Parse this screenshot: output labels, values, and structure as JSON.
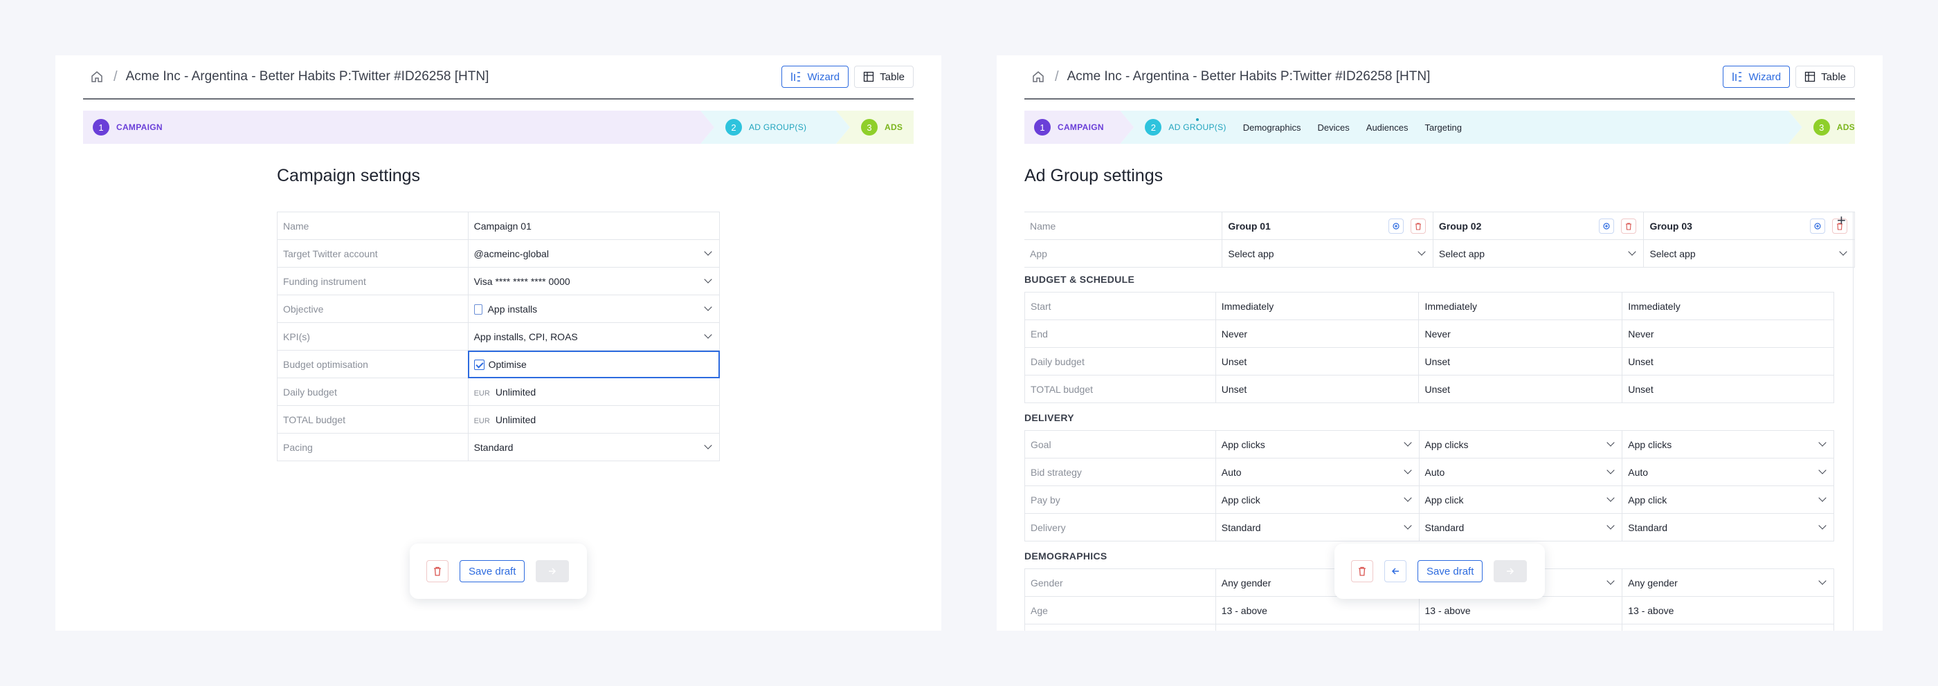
{
  "left": {
    "breadcrumb": "Acme Inc - Argentina - Better Habits P:Twitter #ID26258 [HTN]",
    "view_wizard": "Wizard",
    "view_table": "Table",
    "steps": [
      {
        "num": "1",
        "label": "CAMPAIGN"
      },
      {
        "num": "2",
        "label": "AD GROUP(S)"
      },
      {
        "num": "3",
        "label": "ADS"
      }
    ],
    "heading": "Campaign settings",
    "rows": [
      {
        "label": "Name",
        "value": "Campaign 01"
      },
      {
        "label": "Target Twitter account",
        "value": "@acmeinc-global"
      },
      {
        "label": "Funding instrument",
        "value": "Visa **** **** **** 0000"
      },
      {
        "label": "Objective",
        "value": "App installs"
      },
      {
        "label": "KPI(s)",
        "value": "App installs, CPI, ROAS"
      },
      {
        "label": "Budget optimisation",
        "value": "Optimise"
      },
      {
        "label": "Daily budget",
        "currency": "EUR",
        "value": "Unlimited"
      },
      {
        "label": "TOTAL budget",
        "currency": "EUR",
        "value": "Unlimited"
      },
      {
        "label": "Pacing",
        "value": "Standard"
      }
    ],
    "save_draft": "Save draft"
  },
  "right": {
    "breadcrumb": "Acme Inc - Argentina - Better Habits P:Twitter #ID26258 [HTN]",
    "view_wizard": "Wizard",
    "view_table": "Table",
    "steps": [
      {
        "num": "1",
        "label": "CAMPAIGN"
      },
      {
        "num": "2",
        "label": "AD GROUP(S)"
      },
      {
        "num": "3",
        "label": "ADS"
      }
    ],
    "substeps": [
      "Demographics",
      "Devices",
      "Audiences",
      "Targeting"
    ],
    "heading": "Ad Group settings",
    "groups": [
      "Group 01",
      "Group 02",
      "Group 03"
    ],
    "name_label": "Name",
    "app_label": "App",
    "app_value": "Select app",
    "sections": {
      "budget": "BUDGET & SCHEDULE",
      "delivery": "DELIVERY",
      "demographics": "DEMOGRAPHICS"
    },
    "budget_rows": [
      {
        "label": "Start",
        "value": "Immediately"
      },
      {
        "label": "End",
        "value": "Never"
      },
      {
        "label": "Daily budget",
        "value": "Unset"
      },
      {
        "label": "TOTAL budget",
        "value": "Unset"
      }
    ],
    "delivery_rows": [
      {
        "label": "Goal",
        "value": "App clicks"
      },
      {
        "label": "Bid strategy",
        "value": "Auto"
      },
      {
        "label": "Pay by",
        "value": "App click"
      },
      {
        "label": "Delivery",
        "value": "Standard"
      }
    ],
    "demo_rows": [
      {
        "label": "Gender",
        "value": "Any gender"
      },
      {
        "label": "Age",
        "value": "13 - above"
      }
    ],
    "save_draft": "Save draft"
  }
}
